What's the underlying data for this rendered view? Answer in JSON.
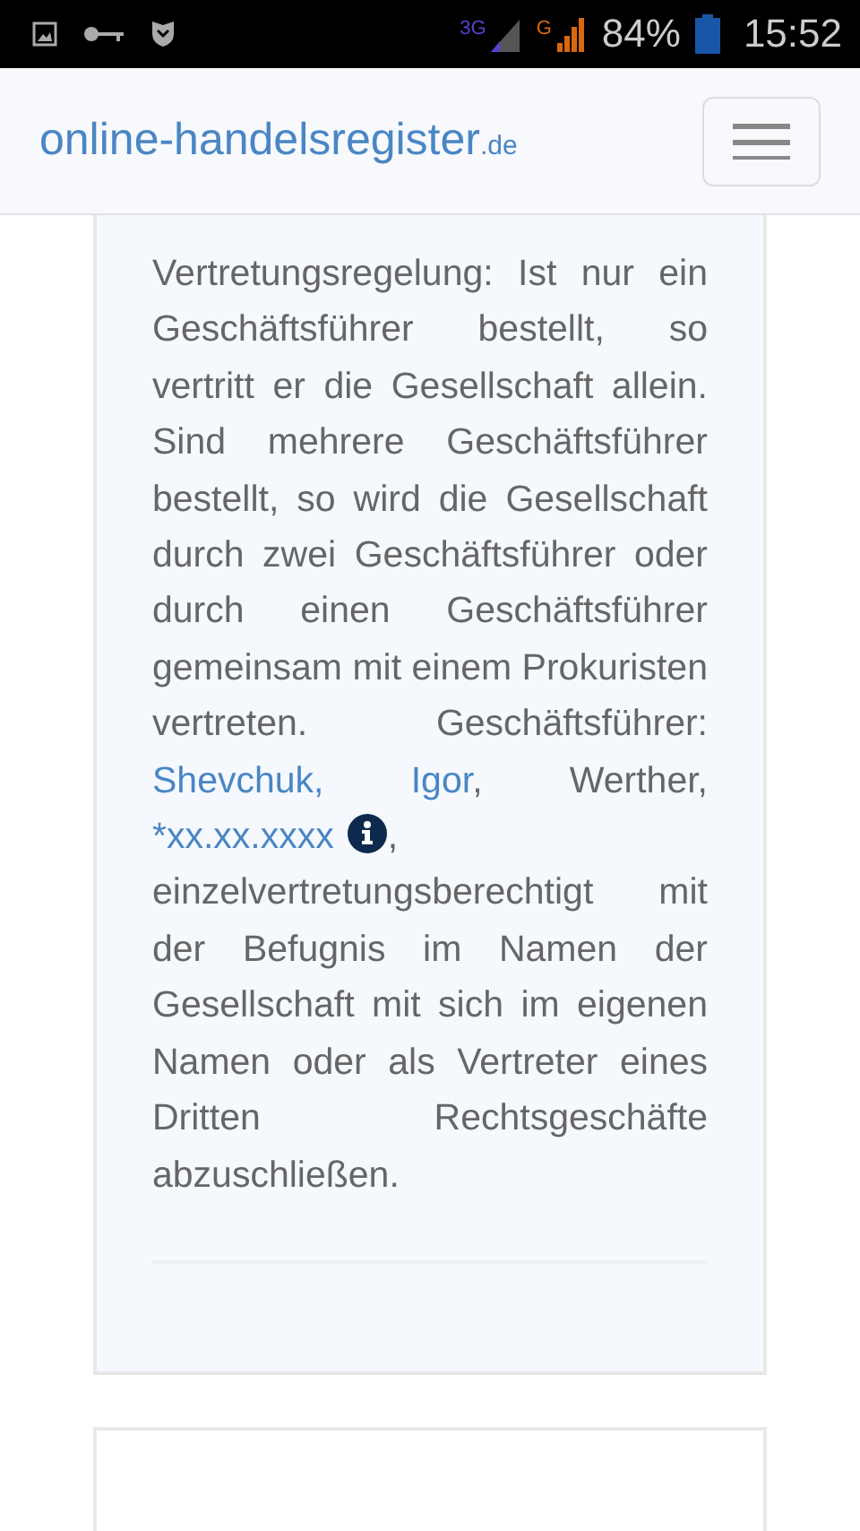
{
  "status_bar": {
    "network_3g": "3G",
    "network_g": "G",
    "battery": "84%",
    "time": "15:52"
  },
  "header": {
    "logo": "online-handelsregister",
    "logo_suffix": ".de"
  },
  "card": {
    "segments": [
      {
        "kind": "text",
        "text": "Vertretungsregelung: Ist nur ein Geschäftsführer bestellt, so vertritt er die Gesellschaft allein. Sind mehrere Geschäftsführer bestellt, so wird die Gesellschaft durch zwei Geschäftsführer oder durch einen Geschäftsführer gemeinsam mit einem Prokuristen vertreten. Geschäftsführer: "
      },
      {
        "kind": "link",
        "text": "Shevchuk, Igor"
      },
      {
        "kind": "text",
        "text": ", Werther, "
      },
      {
        "kind": "link",
        "text": "*xx.xx.xxxx"
      },
      {
        "kind": "info"
      },
      {
        "kind": "text",
        "text": ", einzelvertretungsberechtigt mit der Befugnis im Namen der Gesellschaft mit sich im eigenen Namen oder als Vertreter eines Dritten Rechtsgeschäfte abzuschließen."
      }
    ]
  }
}
